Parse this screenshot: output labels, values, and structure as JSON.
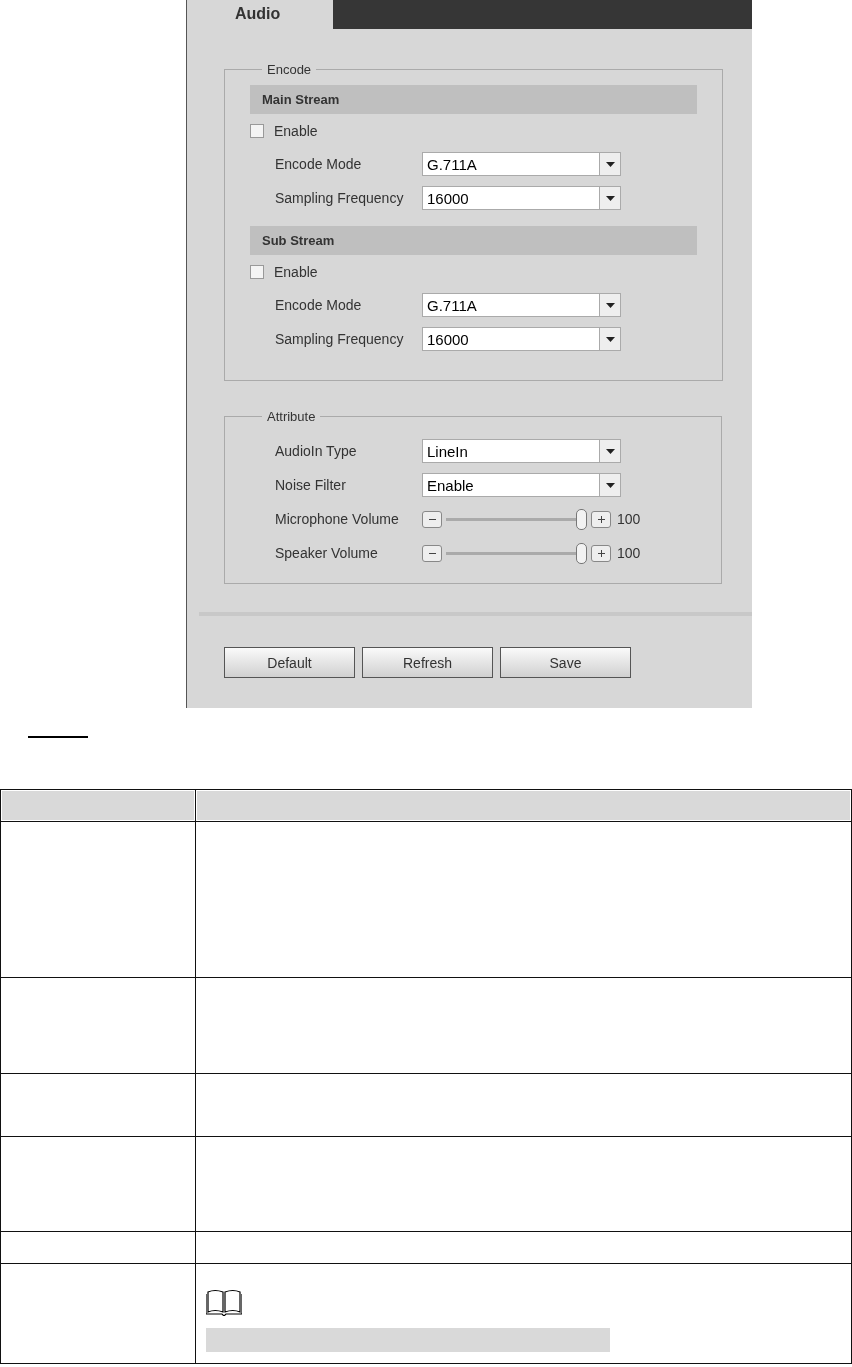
{
  "tabs": [
    {
      "label": "Audio",
      "selected": true
    }
  ],
  "encode": {
    "legend": "Encode",
    "streams": [
      {
        "title": "Main Stream",
        "enable": {
          "label": "Enable",
          "checked": false
        },
        "fields": [
          {
            "label": "Encode Mode",
            "value": "G.711A"
          },
          {
            "label": "Sampling Frequency",
            "value": "16000"
          }
        ]
      },
      {
        "title": "Sub Stream",
        "enable": {
          "label": "Enable",
          "checked": false
        },
        "fields": [
          {
            "label": "Encode Mode",
            "value": "G.711A"
          },
          {
            "label": "Sampling Frequency",
            "value": "16000"
          }
        ]
      }
    ]
  },
  "attribute": {
    "legend": "Attribute",
    "rows": [
      {
        "kind": "select",
        "label": "AudioIn Type",
        "value": "LineIn"
      },
      {
        "kind": "select",
        "label": "Noise Filter",
        "value": "Enable"
      },
      {
        "kind": "slider",
        "label": "Microphone Volume",
        "level": 1,
        "reading": "100"
      },
      {
        "kind": "slider",
        "label": "Speaker Volume",
        "level": 1,
        "reading": "100"
      }
    ]
  },
  "buttons": [
    "Default",
    "Refresh",
    "Save"
  ]
}
